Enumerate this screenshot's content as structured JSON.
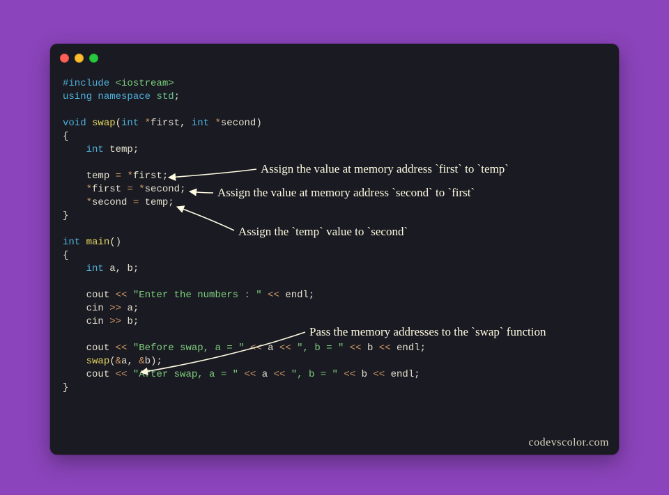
{
  "colors": {
    "page_bg": "#8b44bb",
    "window_bg": "#1a1a22",
    "keyword": "#4fb0d9",
    "function": "#e6d95f",
    "classname": "#6dc48a",
    "string": "#7ed07e",
    "operator": "#d19a66",
    "text": "#e6e1cf",
    "annotation": "#fdfae1"
  },
  "code": {
    "l1": {
      "include": "#include ",
      "header": "<iostream>"
    },
    "l2": {
      "using": "using ",
      "namespace": "namespace ",
      "std": "std",
      "semi": ";"
    },
    "l4": {
      "void": "void ",
      "swap": "swap",
      "lpar": "(",
      "int1": "int ",
      "star1": "*",
      "first": "first",
      "comma": ", ",
      "int2": "int ",
      "star2": "*",
      "second": "second",
      "rpar": ")"
    },
    "l5": {
      "brace": "{"
    },
    "l6": {
      "indent": "    ",
      "int": "int ",
      "temp": "temp",
      "semi": ";"
    },
    "l8": {
      "indent": "    ",
      "temp": "temp ",
      "eq": "= ",
      "star": "*",
      "first": "first",
      "semi": ";"
    },
    "l9": {
      "indent": "    ",
      "star1": "*",
      "first": "first ",
      "eq": "= ",
      "star2": "*",
      "second": "second",
      "semi": ";"
    },
    "l10": {
      "indent": "    ",
      "star": "*",
      "second": "second ",
      "eq": "= ",
      "temp": "temp",
      "semi": ";"
    },
    "l11": {
      "brace": "}"
    },
    "l13": {
      "int": "int ",
      "main": "main",
      "lpar": "(",
      "rpar": ")"
    },
    "l14": {
      "brace": "{"
    },
    "l15": {
      "indent": "    ",
      "int": "int ",
      "a": "a",
      "comma": ", ",
      "b": "b",
      "semi": ";"
    },
    "l17": {
      "indent": "    ",
      "cout": "cout ",
      "lt1": "<< ",
      "str": "\"Enter the numbers : \"",
      "sp2": " ",
      "lt2": "<< ",
      "endl": "endl",
      "semi": ";"
    },
    "l18": {
      "indent": "    ",
      "cin": "cin ",
      "gt": ">> ",
      "a": "a",
      "semi": ";"
    },
    "l19": {
      "indent": "    ",
      "cin": "cin ",
      "gt": ">> ",
      "b": "b",
      "semi": ";"
    },
    "l21": {
      "indent": "    ",
      "cout": "cout ",
      "lt1": "<< ",
      "str1": "\"Before swap, a = \"",
      "sp": " ",
      "lt2": "<< ",
      "a": "a ",
      "lt3": "<< ",
      "str2": "\", b = \"",
      "sp2": " ",
      "lt4": "<< ",
      "b": "b ",
      "lt5": "<< ",
      "endl": "endl",
      "semi": ";"
    },
    "l22": {
      "indent": "    ",
      "swap": "swap",
      "lpar": "(",
      "amp1": "&",
      "a": "a",
      "comma": ", ",
      "amp2": "&",
      "b": "b",
      "rpar": ")",
      "semi": ";"
    },
    "l23": {
      "indent": "    ",
      "cout": "cout ",
      "lt1": "<< ",
      "str1": "\"After swap, a = \"",
      "sp": " ",
      "lt2": "<< ",
      "a": "a ",
      "lt3": "<< ",
      "str2": "\", b = \"",
      "sp2": " ",
      "lt4": "<< ",
      "b": "b ",
      "lt5": "<< ",
      "endl": "endl",
      "semi": ";"
    },
    "l24": {
      "brace": "}"
    }
  },
  "annotations": {
    "a1": "Assign the value at memory address `first` to `temp`",
    "a2": "Assign the value at memory address `second` to `first`",
    "a3": "Assign the `temp` value to `second`",
    "a4": "Pass the memory addresses to the `swap` function"
  },
  "watermark": "codevscolor.com"
}
